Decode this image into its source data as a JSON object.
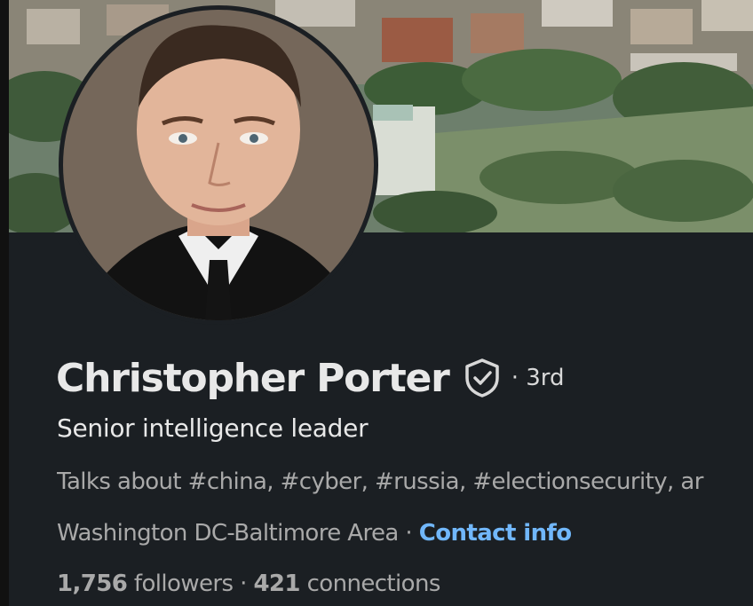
{
  "profile": {
    "name": "Christopher Porter",
    "degree": "· 3rd",
    "headline": "Senior intelligence leader",
    "talks_about": "Talks about #china, #cyber, #russia, #electionsecurity, ar",
    "location": "Washington DC-Baltimore Area",
    "location_separator": " · ",
    "contact_label": "Contact info",
    "followers_count": "1,756",
    "followers_label": " followers",
    "followers_separator": "  · ",
    "connections_count": "421",
    "connections_label": " connections"
  },
  "icons": {
    "verified": "shield-check-icon"
  },
  "colors": {
    "background": "#1b1f23",
    "primary_text": "#e8e8e8",
    "secondary_text": "#a9a9a9",
    "link": "#71b7fb"
  }
}
